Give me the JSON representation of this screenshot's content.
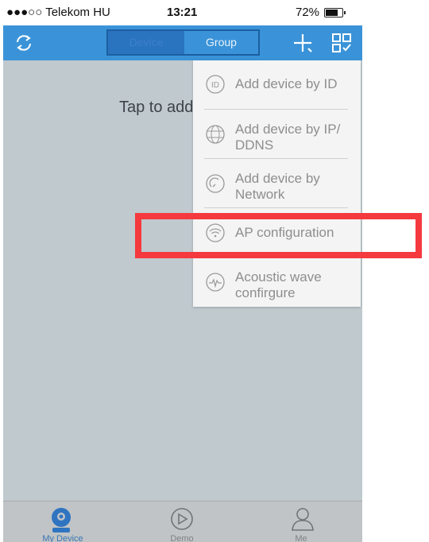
{
  "status": {
    "carrier": "●●●○○ Telekom HU",
    "time": "13:21",
    "battery": "72%"
  },
  "nav": {
    "segment_device": "Device",
    "segment_group": "Group"
  },
  "main": {
    "placeholder_text": "Tap to add"
  },
  "menu": {
    "items": [
      {
        "label": "Add device by ID"
      },
      {
        "label": "Add device by IP/\nDDNS"
      },
      {
        "label": "Add device by\nNetwork"
      },
      {
        "label": "AP configuration"
      },
      {
        "label": "Acoustic wave\nconfirgure"
      }
    ]
  },
  "tabs": [
    {
      "label": "My Device"
    },
    {
      "label": "Demo"
    },
    {
      "label": "Me"
    }
  ],
  "colors": {
    "nav": "#3a93d8",
    "highlight": "#f43a3e",
    "active_tab": "#3a76b4"
  }
}
